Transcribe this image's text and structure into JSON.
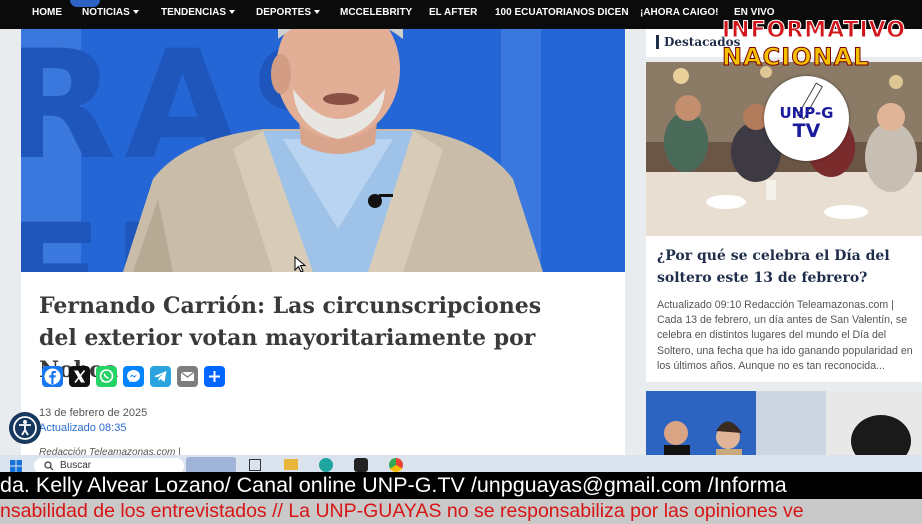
{
  "nav": {
    "items": [
      "HOME",
      "NOTICIAS",
      "TENDENCIAS",
      "DEPORTES",
      "MCCELEBRITY",
      "EL AFTER",
      "100 ECUATORIANOS DICEN",
      "¡AHORA CAIGO!",
      "EN VIVO"
    ],
    "dropdown_items": [
      "NOTICIAS",
      "TENDENCIAS",
      "DEPORTES"
    ]
  },
  "article": {
    "headline": "Fernando Carrión: Las circunscripciones del exterior votan mayoritariamente por Noboa",
    "date": "13 de febrero de 2025",
    "updated": "Actualizado 08:35",
    "byline": "Redacción Teleamazonas.com |",
    "share_icons": [
      "facebook-icon",
      "x-icon",
      "whatsapp-icon",
      "messenger-icon",
      "telegram-icon",
      "email-icon",
      "share-icon"
    ],
    "video_background_text": "RAS EN"
  },
  "sidebar": {
    "title": "Destacados",
    "card": {
      "title": "¿Por qué se celebra el Día del soltero este 13 de febrero?",
      "body": "Actualizado 09:10 Redacción Teleamazonas.com | Cada 13 de febrero, un día antes de San Valentín, se celebra en distintos lugares del mundo el Día del Soltero, una fecha que ha ido ganando popularidad en los últimos años. Aunque no es tan reconocida..."
    }
  },
  "overlay": {
    "brand_line1": "INFORMATIVO",
    "brand_line2": "NACIONAL",
    "badge_line1": "UNP-G",
    "badge_line2": "TV"
  },
  "taskbar": {
    "search_placeholder": "Buscar"
  },
  "ticker": {
    "line1": "da. Kelly Alvear Lozano/ Canal online UNP-G.TV /unpguayas@gmail.com /Informa",
    "line2": "nsabilidad de los entrevistados // La UNP-GUAYAS no se responsabiliza por las opiniones ve"
  },
  "colors": {
    "nav_bg": "#0b0b0b",
    "headline": "#3a3a3a",
    "link_blue": "#2b6dd0",
    "ticker_red": "#d81515",
    "studio_blue": "#2566d6"
  }
}
